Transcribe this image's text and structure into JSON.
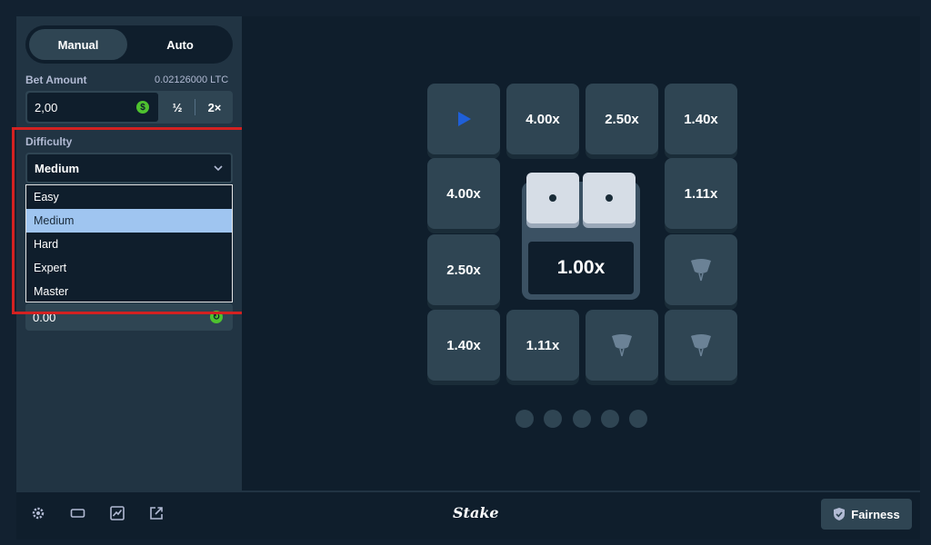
{
  "mode_toggle": {
    "manual_label": "Manual",
    "auto_label": "Auto"
  },
  "bet": {
    "label": "Bet Amount",
    "crypto_value": "0.02126000 LTC",
    "value": "2,00",
    "currency_icon": "dollar-coin-icon",
    "half_label": "½",
    "double_label": "2×"
  },
  "difficulty": {
    "label": "Difficulty",
    "selected": "Medium",
    "options": [
      "Easy",
      "Medium",
      "Hard",
      "Expert",
      "Master"
    ]
  },
  "profit": {
    "value": "0.00"
  },
  "board": {
    "row1": [
      "",
      "4.00x",
      "2.50x",
      "1.40x"
    ],
    "row2": [
      "4.00x",
      "1.11x"
    ],
    "row3": [
      "2.50x"
    ],
    "row4": [
      "1.40x",
      "1.11x"
    ],
    "center_multiplier": "1.00x"
  },
  "footer": {
    "logo": "Stake",
    "fairness_label": "Fairness"
  },
  "colors": {
    "accent_green": "#4ec22f",
    "panel": "#213443",
    "bg": "#0f1e2c",
    "tile": "#2f4553",
    "highlight_red": "#d32121"
  }
}
